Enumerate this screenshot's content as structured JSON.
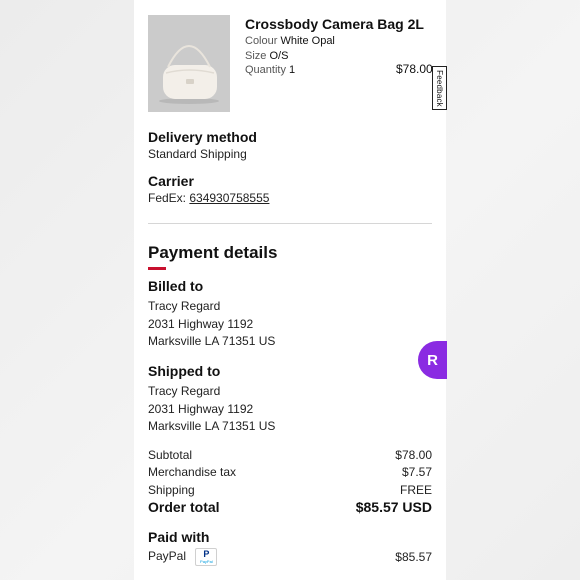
{
  "product": {
    "title": "Crossbody Camera Bag 2L",
    "colour_label": "Colour",
    "colour_value": "White Opal",
    "size_label": "Size",
    "size_value": "O/S",
    "quantity_label": "Quantity",
    "quantity_value": "1",
    "price": "$78.00"
  },
  "feedback_tab": "Feedback",
  "delivery": {
    "heading": "Delivery method",
    "method": "Standard Shipping"
  },
  "carrier": {
    "heading": "Carrier",
    "name": "FedEx:",
    "tracking": "634930758555"
  },
  "payment": {
    "heading": "Payment details",
    "accent_color": "#c8102e"
  },
  "billed_to": {
    "heading": "Billed to",
    "name": "Tracy Regard",
    "street": "2031 Highway 1192",
    "city": "Marksville LA 71351 US"
  },
  "shipped_to": {
    "heading": "Shipped to",
    "name": "Tracy Regard",
    "street": "2031 Highway 1192",
    "city": "Marksville LA 71351 US"
  },
  "summary": {
    "subtotal_label": "Subtotal",
    "subtotal_value": "$78.00",
    "tax_label": "Merchandise tax",
    "tax_value": "$7.57",
    "shipping_label": "Shipping",
    "shipping_value": "FREE",
    "total_label": "Order total",
    "total_value": "$85.57 USD"
  },
  "paid_with": {
    "heading": "Paid with",
    "method": "PayPal",
    "logo_text_big": "P",
    "logo_text_small": "PayPal",
    "amount": "$85.57"
  },
  "badge": {
    "letter": "R",
    "color": "#8a2be2"
  }
}
